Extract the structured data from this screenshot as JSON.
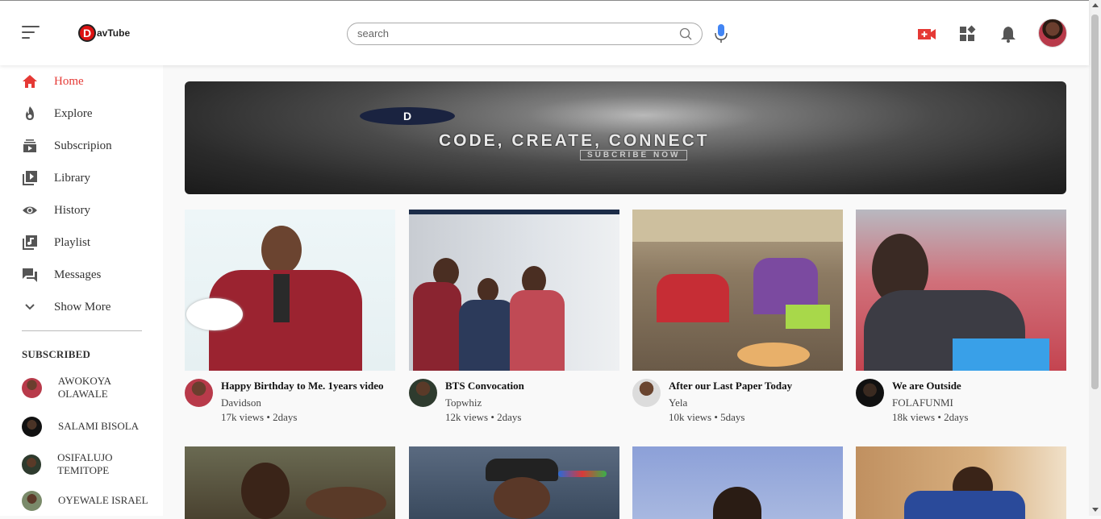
{
  "app": {
    "logo_letter": "D",
    "logo_text": "avTube",
    "brand_color": "#e53935"
  },
  "search": {
    "placeholder": "search"
  },
  "header_icons": [
    "hamburger-menu-icon",
    "search-icon",
    "microphone-icon",
    "add-video-icon",
    "apps-icon",
    "notification-bell-icon"
  ],
  "sidebar": {
    "items": [
      {
        "label": "Home",
        "icon": "home-icon",
        "active": true
      },
      {
        "label": "Explore",
        "icon": "flame-icon"
      },
      {
        "label": "Subscripion",
        "icon": "subscriptions-icon"
      },
      {
        "label": "Library",
        "icon": "video-library-icon"
      },
      {
        "label": "History",
        "icon": "eye-icon"
      },
      {
        "label": "Playlist",
        "icon": "playlist-icon"
      },
      {
        "label": "Messages",
        "icon": "messages-icon"
      },
      {
        "label": "Show More",
        "icon": "chevron-down-icon"
      }
    ],
    "subscribed_title": "SUBSCRIBED",
    "subscriptions": [
      {
        "name": "AWOKOYA OLAWALE"
      },
      {
        "name": "SALAMI BISOLA"
      },
      {
        "name": "OSIFALUJO TEMITOPE"
      },
      {
        "name": "OYEWALE ISRAEL"
      }
    ]
  },
  "banner": {
    "badge": "D",
    "title": "CODE, CREATE, CONNECT",
    "subtitle": "SUBCRIBE NOW"
  },
  "videos": [
    {
      "title": "Happy Birthday to Me. 1years video",
      "channel": "Davidson",
      "stats": "17k views • 2days"
    },
    {
      "title": "BTS Convocation",
      "channel": "Topwhiz",
      "stats": "12k views • 2days"
    },
    {
      "title": "After our Last Paper Today",
      "channel": "Yela",
      "stats": "10k views • 5days"
    },
    {
      "title": "We are Outside",
      "channel": "FOLAFUNMI",
      "stats": "18k views • 2days"
    }
  ]
}
